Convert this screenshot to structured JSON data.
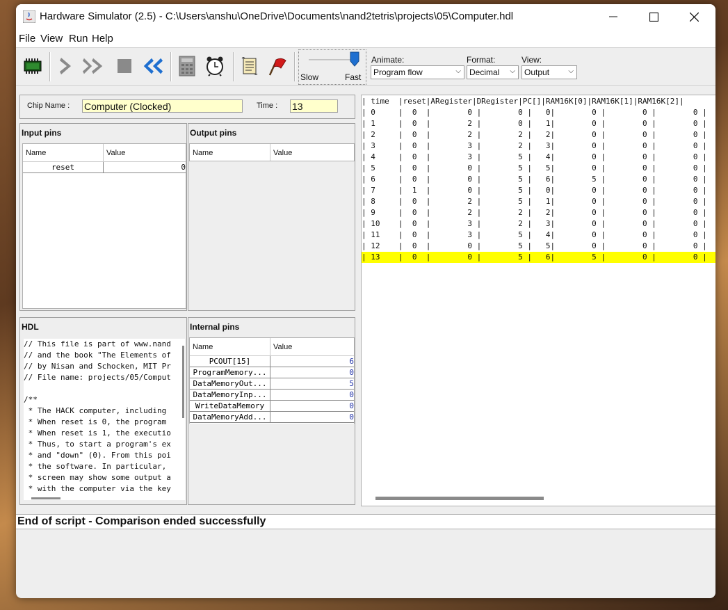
{
  "window": {
    "title": "Hardware Simulator (2.5) - C:\\Users\\anshu\\OneDrive\\Documents\\nand2tetris\\projects\\05\\Computer.hdl"
  },
  "menu": [
    "File",
    "View",
    "Run",
    "Help"
  ],
  "toolbar": {
    "speed_slow": "Slow",
    "speed_fast": "Fast",
    "speed_level": 1.0,
    "animate_label": "Animate:",
    "animate_value": "Program flow",
    "format_label": "Format:",
    "format_value": "Decimal",
    "view_label": "View:",
    "view_value": "Output"
  },
  "chip": {
    "name_label": "Chip Name :",
    "name_value": "Computer (Clocked)",
    "time_label": "Time :",
    "time_value": "13"
  },
  "input_pins": {
    "title": "Input pins",
    "col_name": "Name",
    "col_value": "Value",
    "rows": [
      {
        "name": "reset",
        "value": "0"
      }
    ]
  },
  "output_pins": {
    "title": "Output pins",
    "col_name": "Name",
    "col_value": "Value"
  },
  "hdl": {
    "title": "HDL",
    "lines": [
      "// This file is part of www.nand",
      "// and the book \"The Elements of",
      "// by Nisan and Schocken, MIT Pr",
      "// File name: projects/05/Comput",
      "",
      "/**",
      " * The HACK computer, including",
      " * When reset is 0, the program",
      " * When reset is 1, the executio",
      " * Thus, to start a program's ex",
      " * and \"down\" (0). From this poi",
      " * the software. In particular,",
      " * screen may show some output a",
      " * with the computer via the key"
    ]
  },
  "internal_pins": {
    "title": "Internal pins",
    "col_name": "Name",
    "col_value": "Value",
    "rows": [
      {
        "name": "PCOUT[15]",
        "value": "6"
      },
      {
        "name": "ProgramMemory...",
        "value": "0"
      },
      {
        "name": "DataMemoryOut...",
        "value": "5"
      },
      {
        "name": "DataMemoryInp...",
        "value": "0"
      },
      {
        "name": "WriteDataMemory",
        "value": "0"
      },
      {
        "name": "DataMemoryAdd...",
        "value": "0"
      }
    ]
  },
  "output_table": {
    "header": "| time  |reset|ARegister|DRegister|PC[]|RAM16K[0]|RAM16K[1]|RAM16K[2]|",
    "lines": [
      "| 0     |  0  |        0 |        0 |   0|        0 |        0 |        0 |",
      "| 1     |  0  |        2 |        0 |   1|        0 |        0 |        0 |",
      "| 2     |  0  |        2 |        2 |   2|        0 |        0 |        0 |",
      "| 3     |  0  |        3 |        2 |   3|        0 |        0 |        0 |",
      "| 4     |  0  |        3 |        5 |   4|        0 |        0 |        0 |",
      "| 5     |  0  |        0 |        5 |   5|        0 |        0 |        0 |",
      "| 6     |  0  |        0 |        5 |   6|        5 |        0 |        0 |",
      "| 7     |  1  |        0 |        5 |   0|        0 |        0 |        0 |",
      "| 8     |  0  |        2 |        5 |   1|        0 |        0 |        0 |",
      "| 9     |  0  |        2 |        2 |   2|        0 |        0 |        0 |",
      "| 10    |  0  |        3 |        2 |   3|        0 |        0 |        0 |",
      "| 11    |  0  |        3 |        5 |   4|        0 |        0 |        0 |",
      "| 12    |  0  |        0 |        5 |   5|        0 |        0 |        0 |",
      "| 13    |  0  |        0 |        5 |   6|        5 |        0 |        0 |"
    ],
    "highlight_color": "#ffff00"
  },
  "status": {
    "message": "End of script - Comparison ended successfully"
  }
}
